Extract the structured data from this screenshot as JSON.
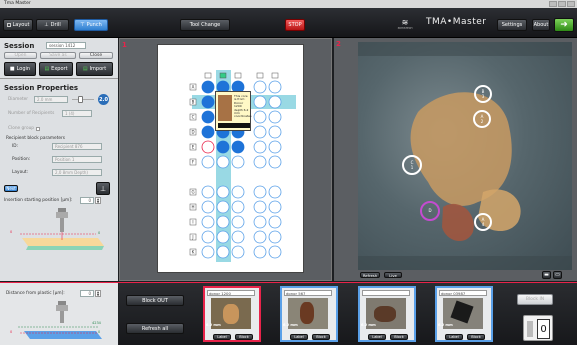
{
  "window": {
    "title": "Tma Master"
  },
  "toolbar": {
    "layout_label": "Layout",
    "drill_label": "Drill",
    "punch_label": "Punch",
    "tool_change_label": "Tool Change",
    "stop_label": "STOP",
    "vendor_label": "3DHISTECH",
    "app_logo": "TMA•Master",
    "settings_label": "Settings",
    "about_label": "About",
    "exit_icon": "exit-arrow-icon"
  },
  "session": {
    "title": "Session",
    "name_value": "session 1412",
    "open_label": "Open",
    "save_as_label": "Save as",
    "close_label": "Close",
    "login_label": "Login",
    "export_label": "Export",
    "import_label": "Import"
  },
  "session_properties": {
    "title": "Session Properties",
    "diameter_label": "Diameter",
    "diameter_value": "2.0 mm",
    "diameter_badge": "2.0",
    "recipients_label": "Number of Recipients",
    "recipients_value": "1 (4)",
    "clone_group_label": "Clone group",
    "recipient_block_label": "Recipient block parameters",
    "id_label": "ID:",
    "id_value": "Recipient 876",
    "position_label": "Position:",
    "position_value": "Position 1",
    "layout_label": "Layout:",
    "layout_value": "2,0 8mm Depth)",
    "next_label": "Next",
    "insertion_label": "Insertion starting position [µm]:",
    "insertion_value": "0",
    "diagram_zero": "0",
    "diagram_right": "0"
  },
  "bottom_left": {
    "distance_label": "Distance from plastic [µm]:",
    "distance_value": "0",
    "diagram_value_a": "4234",
    "diagram_value_b": "0",
    "diagram_left": "0"
  },
  "map": {
    "panel_number": "1",
    "col_markers": [
      "□",
      "■",
      "□",
      "□",
      "□"
    ],
    "row_letters": [
      "A",
      "B",
      "C",
      "D",
      "E",
      "",
      "",
      "F",
      "G",
      "H",
      "I",
      "J",
      "K"
    ],
    "tooltip_text": "This core is from: Donor 1200 depth 6.2 mm coordinates"
  },
  "image": {
    "panel_number": "2",
    "markers": [
      {
        "label": "B\n3",
        "x": ""
      },
      {
        "label": "A\n2"
      },
      {
        "label": "C\n1"
      },
      {
        "label": "D"
      },
      {
        "label": "A\n4"
      }
    ],
    "refresh_label": "Refresh",
    "live_label": "Live"
  },
  "bottom_bar": {
    "block_out_label": "Block OUT",
    "refresh_all_label": "Refresh all",
    "cards": [
      {
        "donor": "donor 1200",
        "depth": "6.2 mm",
        "label_btn": "Label",
        "block_btn": "Block",
        "selected": true
      },
      {
        "donor": "donor 567",
        "depth": "6.2 mm",
        "label_btn": "Label",
        "block_btn": "Block",
        "selected": false
      },
      {
        "donor": "",
        "depth": "6.2 mm",
        "label_btn": "Label",
        "block_btn": "Block",
        "selected": false
      },
      {
        "donor": "donor 03987",
        "depth": "6.2 mm",
        "label_btn": "Label",
        "block_btn": "Block",
        "selected": false
      }
    ],
    "block_in_label": "Block IN",
    "counter_value": "0"
  },
  "colors": {
    "accent_red": "#e8234a",
    "accent_blue": "#5aa0e8",
    "map_highlight": "#6ec9d9"
  }
}
